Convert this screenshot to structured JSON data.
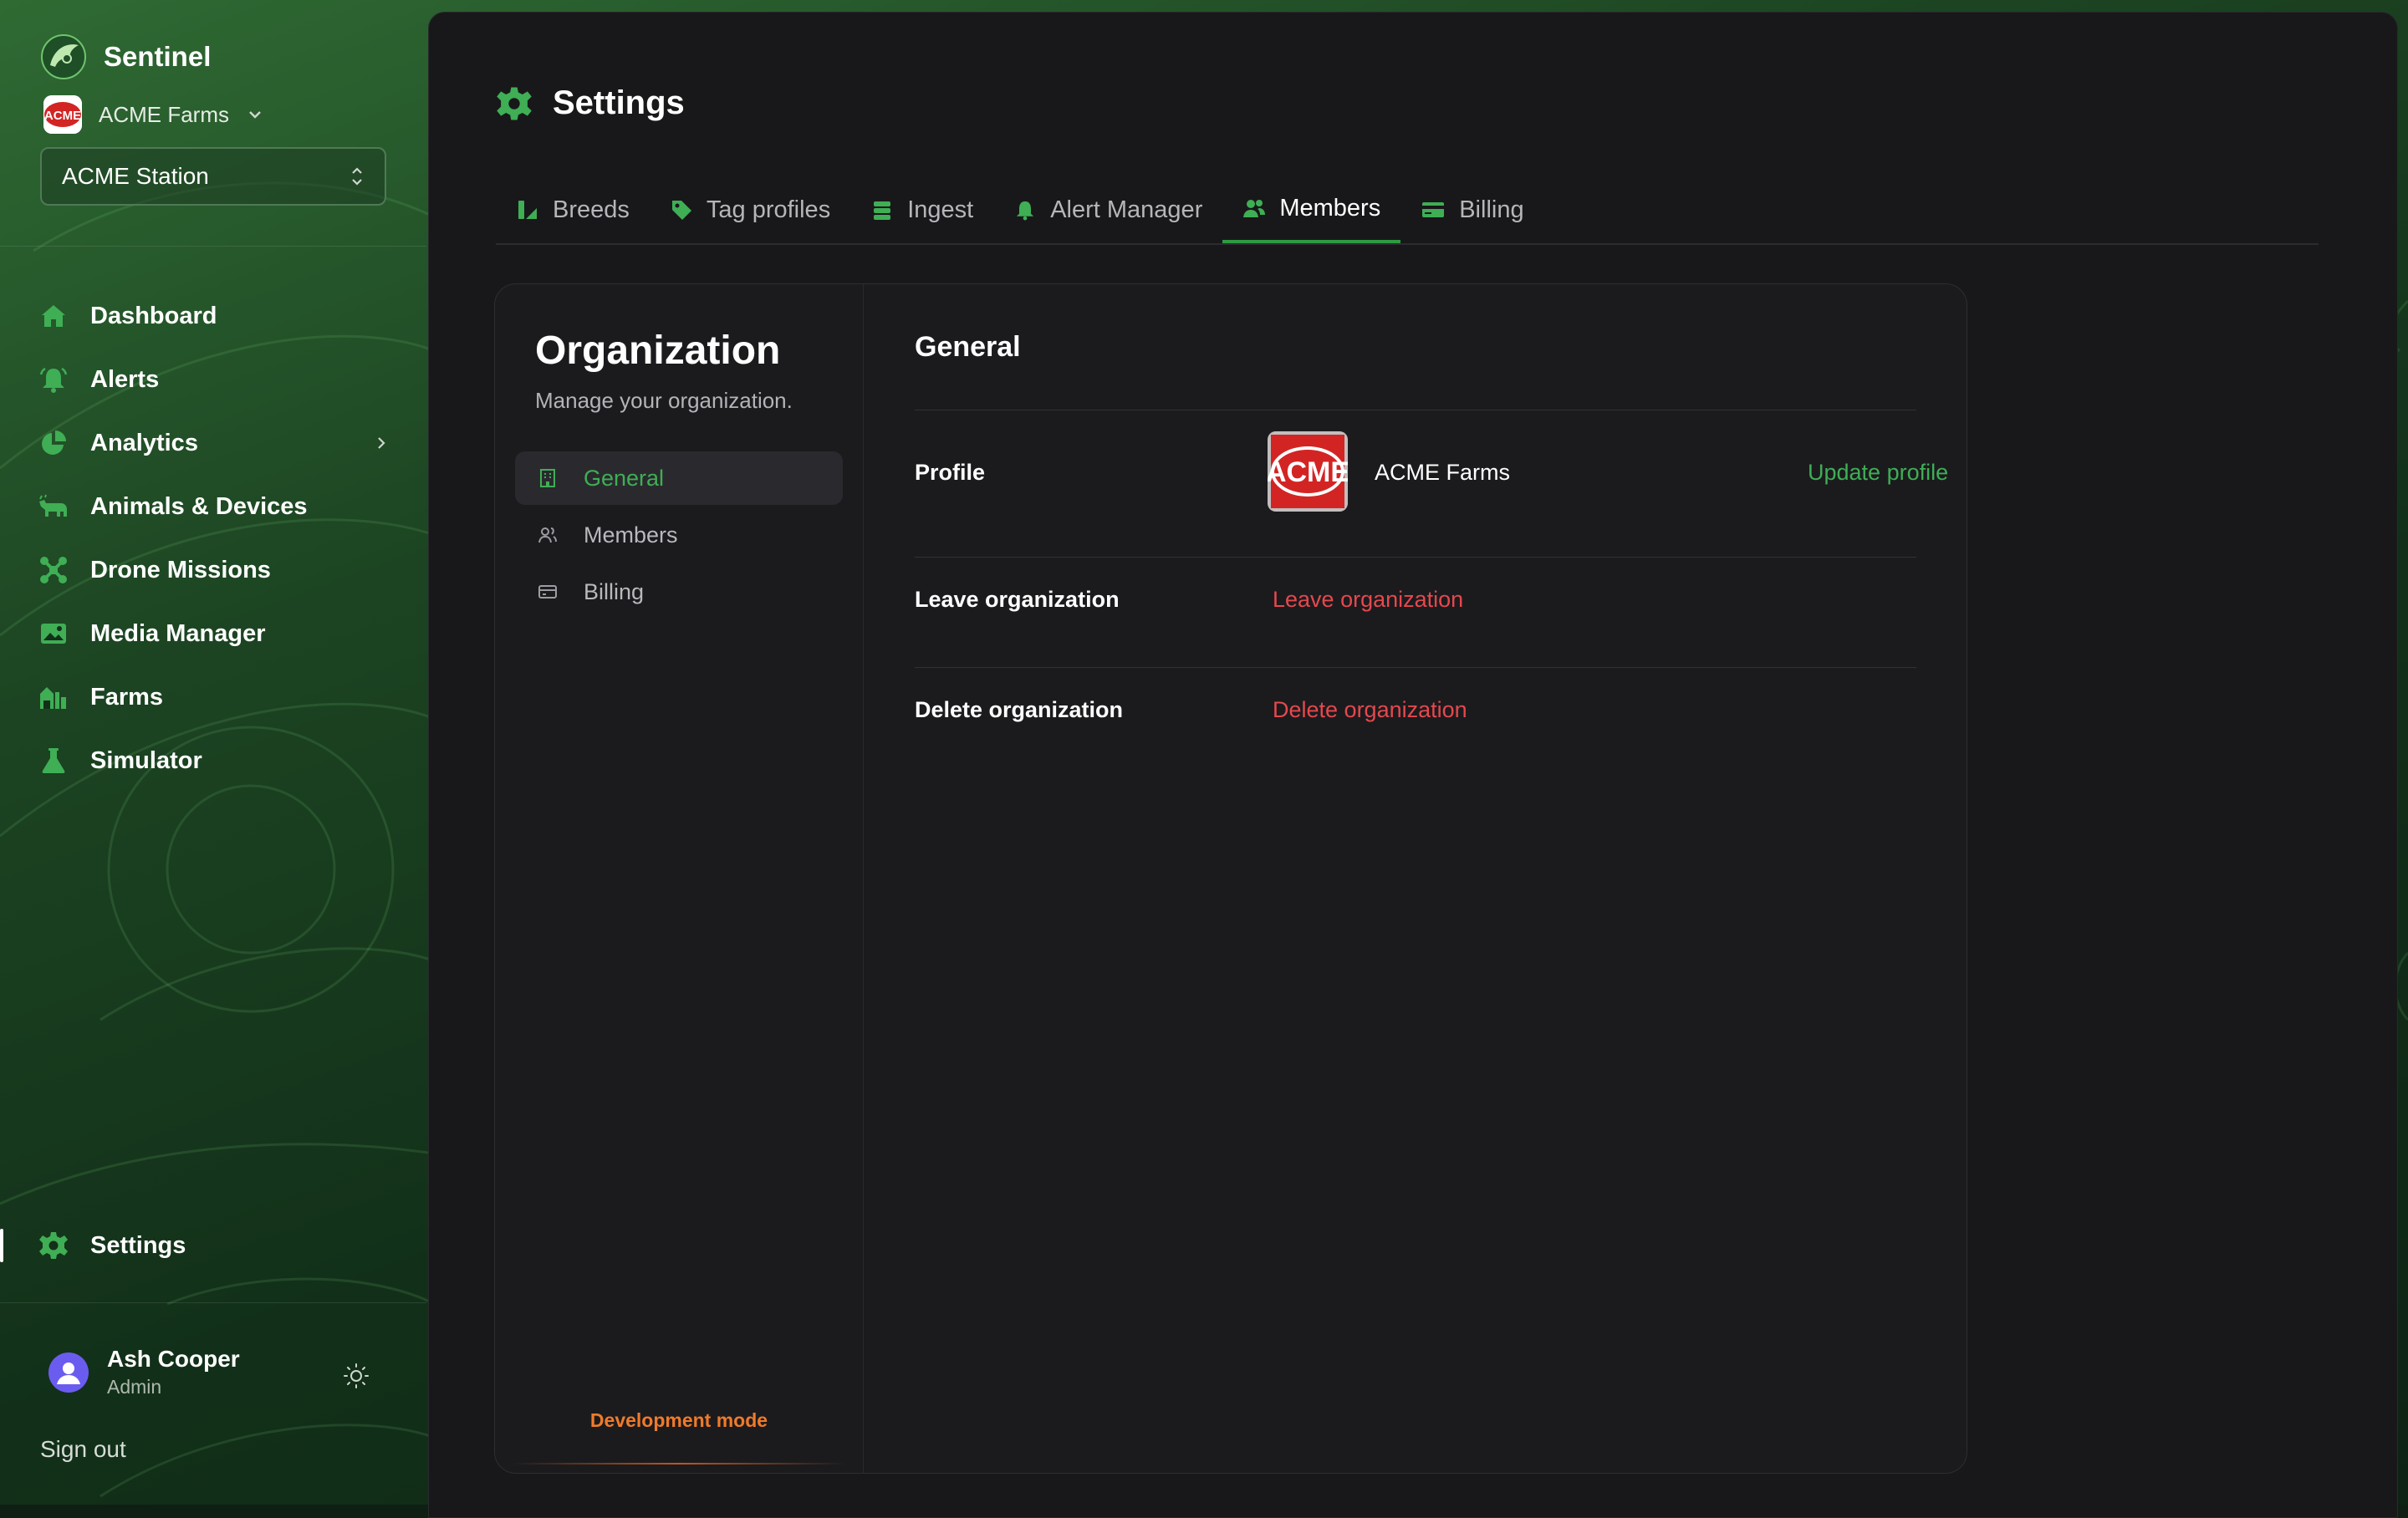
{
  "app": {
    "brand_name": "Sentinel",
    "organization": "ACME Farms",
    "station": "ACME Station",
    "logo_text": "ACME"
  },
  "sidebar": {
    "items": [
      {
        "label": "Dashboard",
        "icon": "home-icon"
      },
      {
        "label": "Alerts",
        "icon": "bell-icon"
      },
      {
        "label": "Analytics",
        "icon": "pie-chart-icon"
      },
      {
        "label": "Animals & Devices",
        "icon": "cow-icon"
      },
      {
        "label": "Drone Missions",
        "icon": "drone-icon"
      },
      {
        "label": "Media Manager",
        "icon": "image-icon"
      },
      {
        "label": "Farms",
        "icon": "barn-icon"
      },
      {
        "label": "Simulator",
        "icon": "flask-icon"
      }
    ],
    "settings_label": "Settings"
  },
  "user": {
    "name": "Ash Cooper",
    "role": "Admin",
    "sign_out": "Sign out"
  },
  "page": {
    "title": "Settings",
    "tabs": [
      {
        "label": "Breeds",
        "icon": "breeds-icon"
      },
      {
        "label": "Tag profiles",
        "icon": "tag-icon"
      },
      {
        "label": "Ingest",
        "icon": "database-icon"
      },
      {
        "label": "Alert Manager",
        "icon": "bell-icon"
      },
      {
        "label": "Members",
        "icon": "users-icon",
        "active": true
      },
      {
        "label": "Billing",
        "icon": "credit-card-icon"
      }
    ]
  },
  "organization_panel": {
    "title": "Organization",
    "subtitle": "Manage your organization.",
    "nav": [
      {
        "label": "General",
        "icon": "building-icon",
        "active": true
      },
      {
        "label": "Members",
        "icon": "users-icon"
      },
      {
        "label": "Billing",
        "icon": "credit-card-icon"
      }
    ],
    "dev_mode": "Development mode"
  },
  "general": {
    "title": "General",
    "profile_label": "Profile",
    "profile_name": "ACME Farms",
    "update_profile": "Update profile",
    "leave_label": "Leave organization",
    "leave_action": "Leave organization",
    "delete_label": "Delete organization",
    "delete_action": "Delete organization"
  },
  "colors": {
    "accent": "#3fae55",
    "danger": "#e5484d",
    "dev_mode": "#f07a2a"
  }
}
